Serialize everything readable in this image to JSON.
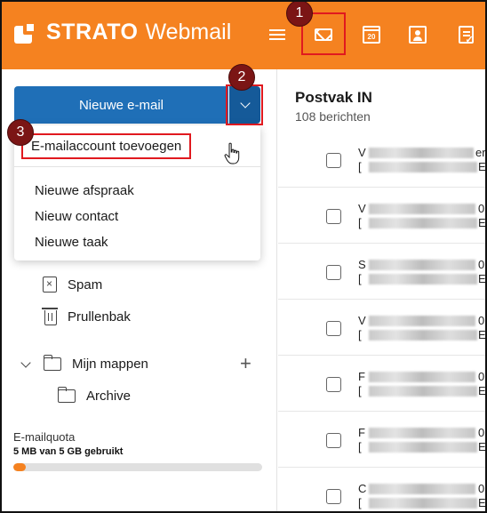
{
  "header": {
    "brand_name": "STRATO",
    "brand_product": "Webmail",
    "icons": [
      "menu-icon",
      "mail-icon",
      "calendar-icon",
      "contacts-icon",
      "tasks-icon"
    ],
    "calendar_day": "20",
    "accent_color": "#f58220"
  },
  "sidebar": {
    "new_email_label": "Nieuwe e-mail",
    "primary_button_color": "#1f6fb7",
    "folders": [
      {
        "label": "Spam",
        "icon": "spam-icon"
      },
      {
        "label": "Prullenbak",
        "icon": "trash-icon"
      }
    ],
    "my_folders_label": "Mijn mappen",
    "subfolder": "Archive",
    "quota_label": "E-mailquota",
    "quota_value": "5 MB van 5 GB gebruikt",
    "quota_fraction": 0.001
  },
  "dropdown": {
    "items": [
      "E-mailaccount toevoegen",
      "Nieuwe afspraak",
      "Nieuw contact",
      "Nieuwe taak"
    ]
  },
  "mail_list": {
    "title": "Postvak IN",
    "count": "108 berichten",
    "rows": [
      {
        "first": "V",
        "second": "[",
        "end1": "er",
        "end2": "E"
      },
      {
        "first": "V",
        "second": "[",
        "end1": "0",
        "end2": "E"
      },
      {
        "first": "S",
        "second": "[",
        "end1": "0",
        "end2": "E"
      },
      {
        "first": "V",
        "second": "[",
        "end1": "0",
        "end2": "E"
      },
      {
        "first": "F",
        "second": "[",
        "end1": "0",
        "end2": "E"
      },
      {
        "first": "F",
        "second": "[",
        "end1": "0",
        "end2": "E"
      },
      {
        "first": "C",
        "second": "[",
        "end1": "0",
        "end2": "E"
      }
    ]
  },
  "annotations": {
    "badges": [
      "1",
      "2",
      "3"
    ],
    "highlight_color": "#e0191f",
    "badge_color": "#7b1515"
  }
}
